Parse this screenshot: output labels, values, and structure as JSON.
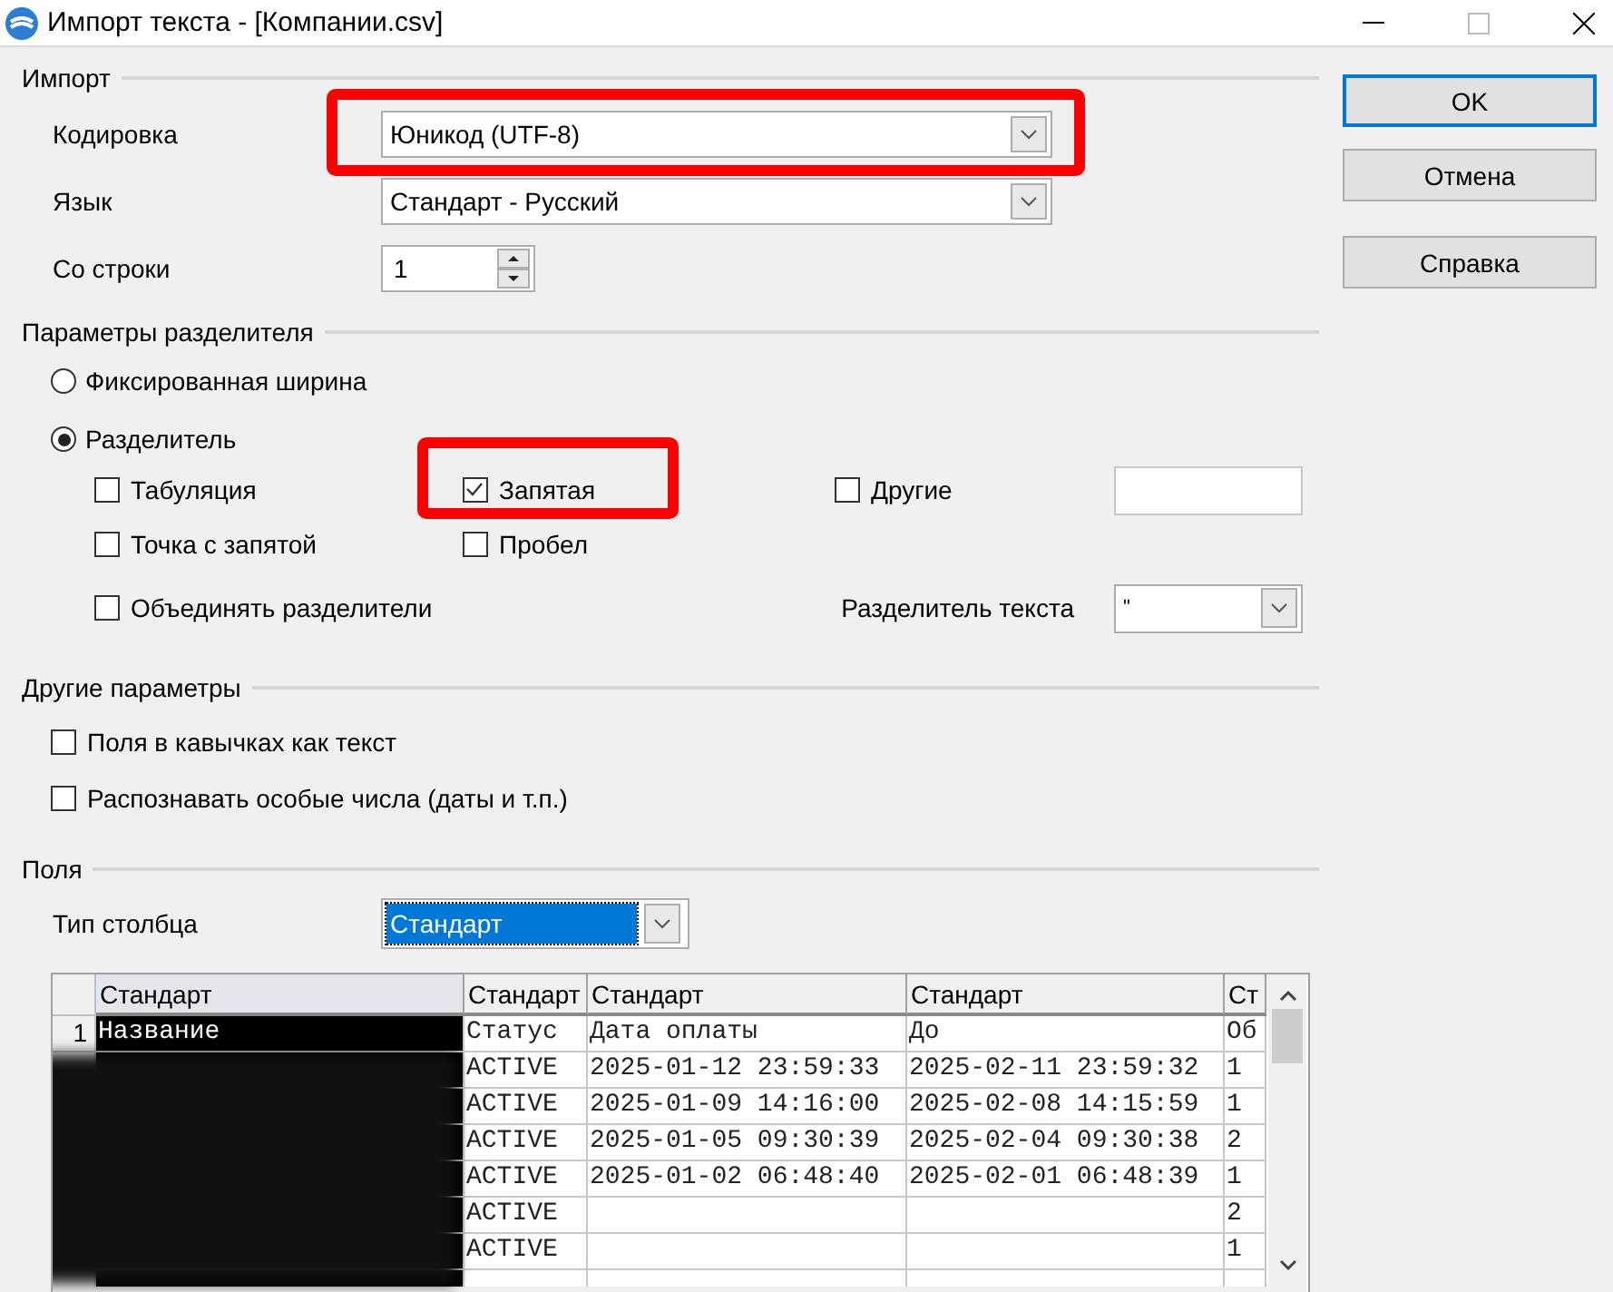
{
  "window": {
    "title": "Импорт текста - [Компании.csv]"
  },
  "import": {
    "heading": "Импорт",
    "encoding": {
      "label": "Кодировка",
      "value": "Юникод (UTF-8)",
      "highlighted": true
    },
    "language": {
      "label": "Язык",
      "value": "Стандарт - Русский"
    },
    "from_row": {
      "label": "Со строки",
      "value": "1"
    }
  },
  "separator_options": {
    "heading": "Параметры разделителя",
    "modes": [
      {
        "label": "Фиксированная ширина",
        "selected": false
      },
      {
        "label": "Разделитель",
        "selected": true
      }
    ],
    "separators": [
      {
        "label": "Табуляция",
        "checked": false,
        "highlighted": false
      },
      {
        "label": "Запятая",
        "checked": true,
        "highlighted": true
      },
      {
        "label": "Другие",
        "checked": false,
        "highlighted": false
      },
      {
        "label": "Точка с запятой",
        "checked": false,
        "highlighted": false
      },
      {
        "label": "Пробел",
        "checked": false,
        "highlighted": false
      }
    ],
    "merge": {
      "label": "Объединять разделители",
      "checked": false
    },
    "text_delimiter": {
      "label": "Разделитель текста",
      "value": "\""
    }
  },
  "other_options": {
    "heading": "Другие параметры",
    "items": [
      {
        "label": "Поля в кавычках как текст",
        "checked": false
      },
      {
        "label": "Распознавать особые числа (даты и т.п.)",
        "checked": false
      }
    ]
  },
  "fields": {
    "heading": "Поля",
    "column_type": {
      "label": "Тип столбца",
      "value": "Стандарт"
    },
    "table": {
      "redacted": true,
      "columns": [
        {
          "label": "Стандарт",
          "selected": true
        },
        {
          "label": "Стандарт",
          "selected": false
        },
        {
          "label": "Стандарт",
          "selected": false
        },
        {
          "label": "Стандарт",
          "selected": false
        },
        {
          "label": "Ст",
          "selected": false
        }
      ],
      "rows": [
        {
          "number": "1",
          "cells": [
            "Название",
            "Статус",
            "Дата оплаты",
            "До",
            "Об"
          ]
        },
        {
          "cells": [
            null,
            "ACTIVE",
            "2025-01-12 23:59:33",
            "2025-02-11 23:59:32",
            "1"
          ]
        },
        {
          "cells": [
            null,
            "ACTIVE",
            "2025-01-09 14:16:00",
            "2025-02-08 14:15:59",
            "1"
          ]
        },
        {
          "cells": [
            null,
            "ACTIVE",
            "2025-01-05 09:30:39",
            "2025-02-04 09:30:38",
            "2"
          ]
        },
        {
          "cells": [
            null,
            "ACTIVE",
            "2025-01-02 06:48:40",
            "2025-02-01 06:48:39",
            "1"
          ]
        },
        {
          "cells": [
            null,
            "ACTIVE",
            null,
            null,
            "2"
          ]
        },
        {
          "cells": [
            null,
            "ACTIVE",
            null,
            null,
            "1"
          ]
        }
      ]
    }
  },
  "buttons": [
    {
      "label": "OK",
      "default": true
    },
    {
      "label": "Отмена",
      "default": false
    },
    {
      "label": "Справка",
      "default": false
    }
  ]
}
